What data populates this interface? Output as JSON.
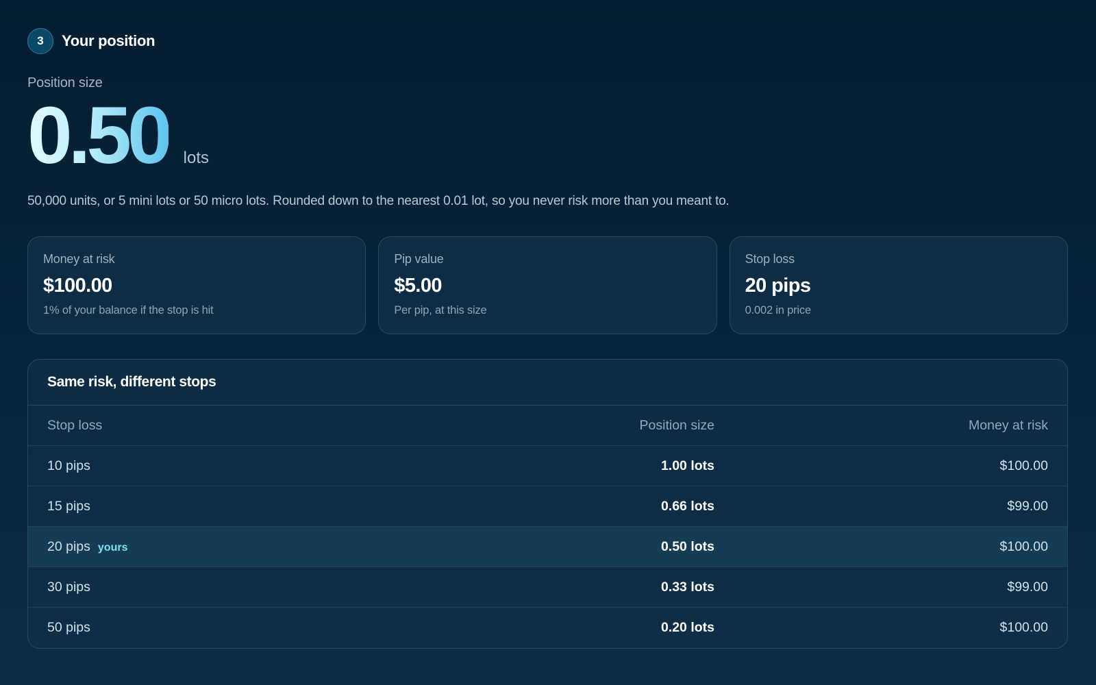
{
  "step": {
    "number": "3",
    "title": "Your position"
  },
  "position": {
    "label": "Position size",
    "value": "0.50",
    "unit": "lots",
    "explanation": "50,000 units, or 5 mini lots or 50 micro lots. Rounded down to the nearest 0.01 lot, so you never risk more than you meant to."
  },
  "cards": [
    {
      "label": "Money at risk",
      "value": "$100.00",
      "sub": "1% of your balance if the stop is hit"
    },
    {
      "label": "Pip value",
      "value": "$5.00",
      "sub": "Per pip, at this size"
    },
    {
      "label": "Stop loss",
      "value": "20 pips",
      "sub": "0.002 in price"
    }
  ],
  "table": {
    "title": "Same risk, different stops",
    "headers": [
      "Stop loss",
      "Position size",
      "Money at risk"
    ],
    "current_tag": "yours",
    "rows": [
      {
        "stop": "10 pips",
        "size": "1.00 lots",
        "risk": "$100.00"
      },
      {
        "stop": "15 pips",
        "size": "0.66 lots",
        "risk": "$99.00"
      },
      {
        "stop": "20 pips",
        "size": "0.50 lots",
        "risk": "$100.00"
      },
      {
        "stop": "30 pips",
        "size": "0.33 lots",
        "risk": "$99.00"
      },
      {
        "stop": "50 pips",
        "size": "0.20 lots",
        "risk": "$100.00"
      }
    ]
  },
  "colors": {
    "background": "#051d30",
    "accent": "#7fe0ef",
    "highlight_row": "#143d55"
  }
}
